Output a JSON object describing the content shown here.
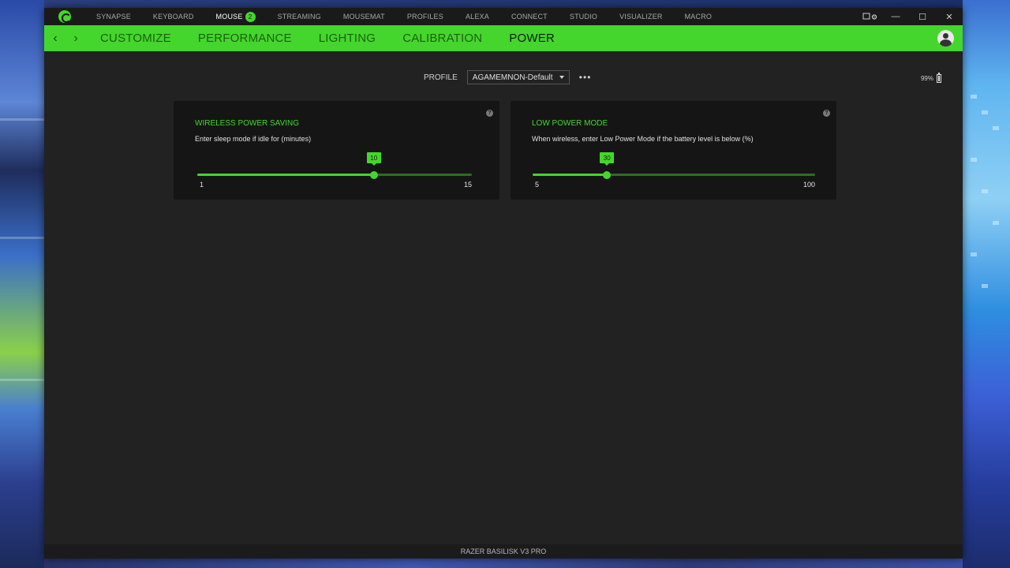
{
  "window": {
    "app_name": "Razer Synapse",
    "device_name": "RAZER BASILISK V3 PRO",
    "controls": {
      "settings_icon": "device-settings-icon",
      "minimize": "—",
      "maximize": "☐",
      "close": "✕"
    }
  },
  "top_nav": {
    "items": [
      {
        "label": "SYNAPSE",
        "active": false
      },
      {
        "label": "KEYBOARD",
        "active": false
      },
      {
        "label": "MOUSE",
        "active": true,
        "badge": "2"
      },
      {
        "label": "STREAMING",
        "active": false
      },
      {
        "label": "MOUSEMAT",
        "active": false
      },
      {
        "label": "PROFILES",
        "active": false
      },
      {
        "label": "ALEXA",
        "active": false
      },
      {
        "label": "CONNECT",
        "active": false
      },
      {
        "label": "STUDIO",
        "active": false
      },
      {
        "label": "VISUALIZER",
        "active": false
      },
      {
        "label": "MACRO",
        "active": false
      }
    ]
  },
  "sub_nav": {
    "back_icon": "‹",
    "forward_icon": "›",
    "tabs": [
      {
        "label": "CUSTOMIZE",
        "active": false
      },
      {
        "label": "PERFORMANCE",
        "active": false
      },
      {
        "label": "LIGHTING",
        "active": false
      },
      {
        "label": "CALIBRATION",
        "active": false
      },
      {
        "label": "POWER",
        "active": true
      }
    ]
  },
  "profile": {
    "label": "PROFILE",
    "selected": "AGAMEMNON-Default",
    "more": "•••"
  },
  "battery": {
    "level_text": "99%",
    "level": 99
  },
  "cards": {
    "wireless_power_saving": {
      "title": "WIRELESS POWER SAVING",
      "description": "Enter sleep mode if idle for (minutes)",
      "help": "?",
      "slider": {
        "min": 1,
        "max": 15,
        "value": 10,
        "min_label": "1",
        "max_label": "15",
        "value_label": "10"
      }
    },
    "low_power_mode": {
      "title": "LOW POWER MODE",
      "description": "When wireless, enter Low Power Mode if the battery level is below (%)",
      "help": "?",
      "slider": {
        "min": 5,
        "max": 100,
        "value": 30,
        "min_label": "5",
        "max_label": "100",
        "value_label": "30"
      }
    }
  },
  "colors": {
    "accent": "#44d62c",
    "background": "#222222",
    "card": "#151515",
    "topbar": "#1a1a1a"
  }
}
